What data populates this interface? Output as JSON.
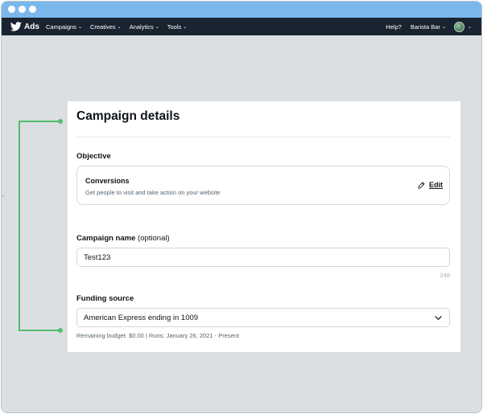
{
  "navbar": {
    "brand": "Ads",
    "items": [
      {
        "label": "Campaigns"
      },
      {
        "label": "Creatives"
      },
      {
        "label": "Analytics"
      },
      {
        "label": "Tools"
      }
    ],
    "help": "Help?",
    "account": "Barista Bar"
  },
  "panel": {
    "title": "Campaign details",
    "objective": {
      "label": "Objective",
      "name": "Conversions",
      "description": "Get people to visit and take action on your website",
      "edit_label": "Edit"
    },
    "campaign_name": {
      "label": "Campaign name",
      "optional": "(optional)",
      "value": "Test123",
      "remaining_chars": "248"
    },
    "funding": {
      "label": "Funding source",
      "selected": "American Express ending in 1009",
      "info": "Remaining budget: $0.00 | Runs: January 26, 2021 - Present"
    }
  },
  "colors": {
    "titlebar": "#7ab8ec",
    "navbar": "#1a2430",
    "bracket": "#4fbf6b",
    "background": "#dcdfe2"
  },
  "icons": [
    "twitter-bird-icon",
    "chevron-down-icon",
    "avatar",
    "pencil-icon"
  ]
}
